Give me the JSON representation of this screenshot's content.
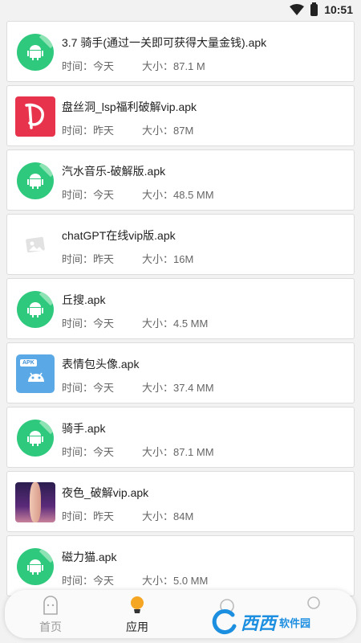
{
  "status_bar": {
    "time": "10:51"
  },
  "items": [
    {
      "title": "3.7 骑手(通过一关即可获得大量金钱).apk",
      "time": "时间：今天",
      "size": "大小：87.1 M",
      "icon": "android-icon"
    },
    {
      "title": "盘丝洞_lsp福利破解vip.apk",
      "time": "时间：昨天",
      "size": "大小：87M",
      "icon": "pansi-app-icon"
    },
    {
      "title": "汽水音乐-破解版.apk",
      "time": "时间：今天",
      "size": "大小：48.5 MM",
      "icon": "android-icon"
    },
    {
      "title": "chatGPT在线vip版.apk",
      "time": "时间：昨天",
      "size": "大小：16M",
      "icon": "image-placeholder-icon"
    },
    {
      "title": "丘搜.apk",
      "time": "时间：今天",
      "size": "大小：4.5 MM",
      "icon": "android-icon"
    },
    {
      "title": "表情包头像.apk",
      "time": "时间：今天",
      "size": "大小：37.4 MM",
      "icon": "apk-icon"
    },
    {
      "title": "骑手.apk",
      "time": "时间：今天",
      "size": "大小：87.1 MM",
      "icon": "android-icon"
    },
    {
      "title": "夜色_破解vip.apk",
      "time": "时间：昨天",
      "size": "大小：84M",
      "icon": "yese-app-icon"
    },
    {
      "title": "磁力猫.apk",
      "time": "时间：今天",
      "size": "大小：5.0 MM",
      "icon": "android-icon"
    }
  ],
  "bottom_nav": {
    "home": "首页",
    "apps": "应用",
    "active_color": "#222222",
    "inactive_color": "#999999"
  },
  "watermark": {
    "main": "西西",
    "sub": "软件园"
  },
  "colors": {
    "android_green": "#2fc97e",
    "accent_yellow": "#f5a623"
  }
}
